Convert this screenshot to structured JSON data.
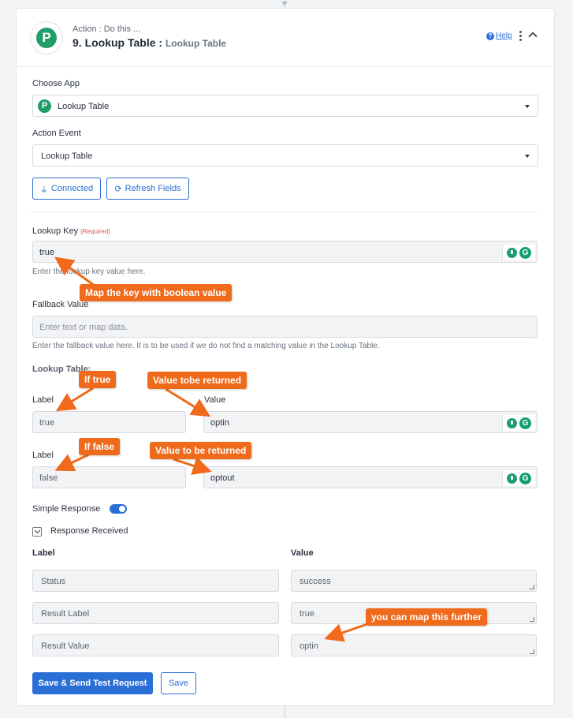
{
  "header": {
    "subtitle": "Action : Do this ...",
    "title": "9. Lookup Table :",
    "title_app": "Lookup Table",
    "help": "Help"
  },
  "app": {
    "logo_letter": "P",
    "choose_app_label": "Choose App",
    "choose_app_value": "Lookup Table",
    "action_event_label": "Action Event",
    "action_event_value": "Lookup Table",
    "connected": "Connected",
    "refresh": "Refresh Fields"
  },
  "lookup_key": {
    "label": "Lookup Key",
    "required": "(Required)",
    "value": "true",
    "hint": "Enter the lookup key value here."
  },
  "fallback": {
    "label": "Fallback Value",
    "placeholder": "Enter text or map data.",
    "hint": "Enter the fallback value here. It is to be used if we do not find a matching value in the Lookup Table."
  },
  "lookup_table": {
    "title": "Lookup Table:",
    "label_header": "Label",
    "value_header": "Value",
    "rows": [
      {
        "label": "true",
        "value": "optin"
      },
      {
        "label": "false",
        "value": "optout"
      }
    ]
  },
  "simple_response": {
    "label": "Simple Response",
    "enabled": true
  },
  "response": {
    "title": "Response Received",
    "label_header": "Label",
    "value_header": "Value",
    "rows": [
      {
        "label": "Status",
        "value": "success"
      },
      {
        "label": "Result Label",
        "value": "true"
      },
      {
        "label": "Result Value",
        "value": "optin"
      }
    ]
  },
  "buttons": {
    "save_test": "Save & Send Test Request",
    "save": "Save"
  },
  "callouts": {
    "map_key": "Map the key with boolean value",
    "if_true": "If true",
    "value_true": "Value tobe returned",
    "if_false": "If false",
    "value_false": "Value to be returned",
    "map_further": "you can map this further"
  },
  "colors": {
    "accent": "#2a6fd6",
    "callout": "#f06a1b",
    "brand_green": "#1f9d6b"
  }
}
